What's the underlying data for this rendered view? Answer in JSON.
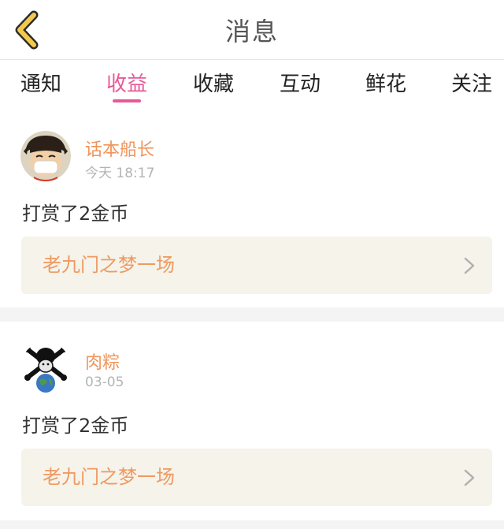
{
  "header": {
    "title": "消息"
  },
  "tabs": [
    {
      "label": "通知"
    },
    {
      "label": "收益",
      "active": true
    },
    {
      "label": "收藏"
    },
    {
      "label": "互动"
    },
    {
      "label": "鲜花"
    },
    {
      "label": "关注"
    }
  ],
  "messages": [
    {
      "user": "话本船长",
      "time": "今天 18:17",
      "action": "打赏了2金币",
      "book": "老九门之梦一场",
      "avatar_icon": "luffy-avatar-icon"
    },
    {
      "user": "肉粽",
      "time": "03-05",
      "action": "打赏了2金币",
      "book": "老九门之梦一场",
      "avatar_icon": "skull-globe-avatar-icon"
    }
  ],
  "colors": {
    "accent": "#e75a98",
    "username": "#f0955c",
    "book_title": "#ef9a62",
    "book_bg": "#f5f3ea",
    "back_arrow": "#f2c94c"
  }
}
